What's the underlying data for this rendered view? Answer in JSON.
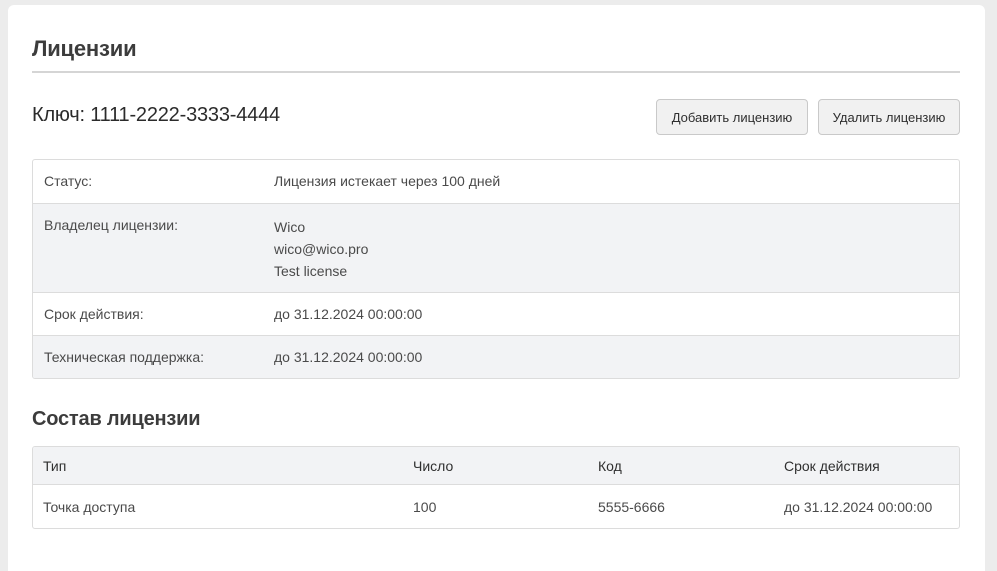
{
  "page": {
    "title": "Лицензии"
  },
  "license": {
    "key_label": "Ключ: 1111-2222-3333-4444",
    "add_button": "Добавить лицензию",
    "delete_button": "Удалить лицензию"
  },
  "info": {
    "status_label": "Статус:",
    "status_value": "Лицензия истекает через 100 дней",
    "owner_label": "Владелец лицензии:",
    "owner_name": "Wico",
    "owner_email": "wico@wico.pro",
    "owner_note": "Test license",
    "validity_label": "Срок действия:",
    "validity_value": "до 31.12.2024 00:00:00",
    "support_label": "Техническая поддержка:",
    "support_value": "до 31.12.2024 00:00:00"
  },
  "composition": {
    "title": "Состав лицензии",
    "headers": [
      "Тип",
      "Число",
      "Код",
      "Срок действия"
    ],
    "rows": [
      [
        "Точка доступа",
        "100",
        "5555-6666",
        "до 31.12.2024 00:00:00"
      ]
    ]
  }
}
